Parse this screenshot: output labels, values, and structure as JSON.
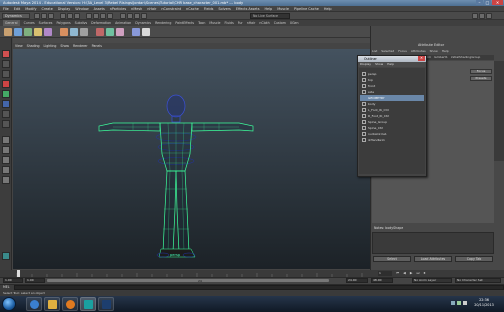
{
  "window": {
    "title": "Autodesk Maya 2014 - Educational Version: H:\\3A_Level 3\\Rebel Risings\\Jordan\\Scenes\\Tutorial\\CHR base_character_001.mb* --- body",
    "min": "–",
    "max": "□",
    "close": "✕"
  },
  "menubar": [
    "File",
    "Edit",
    "Modify",
    "Create",
    "Display",
    "Window",
    "Assets",
    "nParticles",
    "nMesh",
    "nHair",
    "nConstraint",
    "nCache",
    "Fields",
    "Solvers",
    "Effects Assets",
    "Help",
    "Muscle",
    "Pipeline Cache",
    "Help"
  ],
  "statusline": {
    "mode": "Dynamics",
    "surface_field": "No Live Surface"
  },
  "shelf_tabs": [
    "General",
    "Curves",
    "Surfaces",
    "Polygons",
    "Subdivs",
    "Deformation",
    "Animation",
    "Dynamics",
    "Rendering",
    "PaintEffects",
    "Toon",
    "Muscle",
    "Fluids",
    "Fur",
    "nHair",
    "nCloth",
    "Custom",
    "XGen"
  ],
  "viewport": {
    "menu": [
      "View",
      "Shading",
      "Lighting",
      "Show",
      "Renderer",
      "Panels"
    ],
    "camera_label": "persp"
  },
  "attribute_editor": {
    "title": "Attribute Editor",
    "menu": [
      "List",
      "Selected",
      "Focus",
      "Attributes",
      "Show",
      "Help"
    ],
    "tabs": [
      "bodyShape",
      "Joint",
      "Grp",
      "bodyAnim",
      "lambert1",
      "initialShadingGroup"
    ],
    "focus_btn": "Focus",
    "presets_btn": "Presets",
    "notes_label": "Notes: bodyShape",
    "select_btn": "Select",
    "load_btn": "Load Attributes",
    "copy_btn": "Copy Tab"
  },
  "outliner": {
    "title": "Outliner",
    "menu": [
      "Display",
      "Show",
      "Help"
    ],
    "items": [
      "persp",
      "top",
      "front",
      "side",
      "GEOMETRY",
      "body",
      "L_Foot_IK_Ctrl",
      "R_Foot_IK_Ctrl",
      "Spine_Group",
      "Spine_Ctrl",
      "nurbsCircle1",
      "ikHandle11"
    ],
    "selected_index": 4
  },
  "timeline": {
    "current_frame": "1",
    "start_min": "1.00",
    "start": "1.00",
    "range_mid": "24",
    "end": "24.00",
    "end_max": "48.00",
    "anim_layer": "No Anim Layer",
    "char_set": "No Character Set"
  },
  "command": {
    "label": "MEL"
  },
  "helpline": "Select Tool: select an object",
  "taskbar": {
    "time": "22:36",
    "date": "20/11/2013"
  },
  "colors": {
    "wireframe": "#3dff9c",
    "selected_row": "#6a87a8",
    "skeleton": "#2233aa"
  }
}
